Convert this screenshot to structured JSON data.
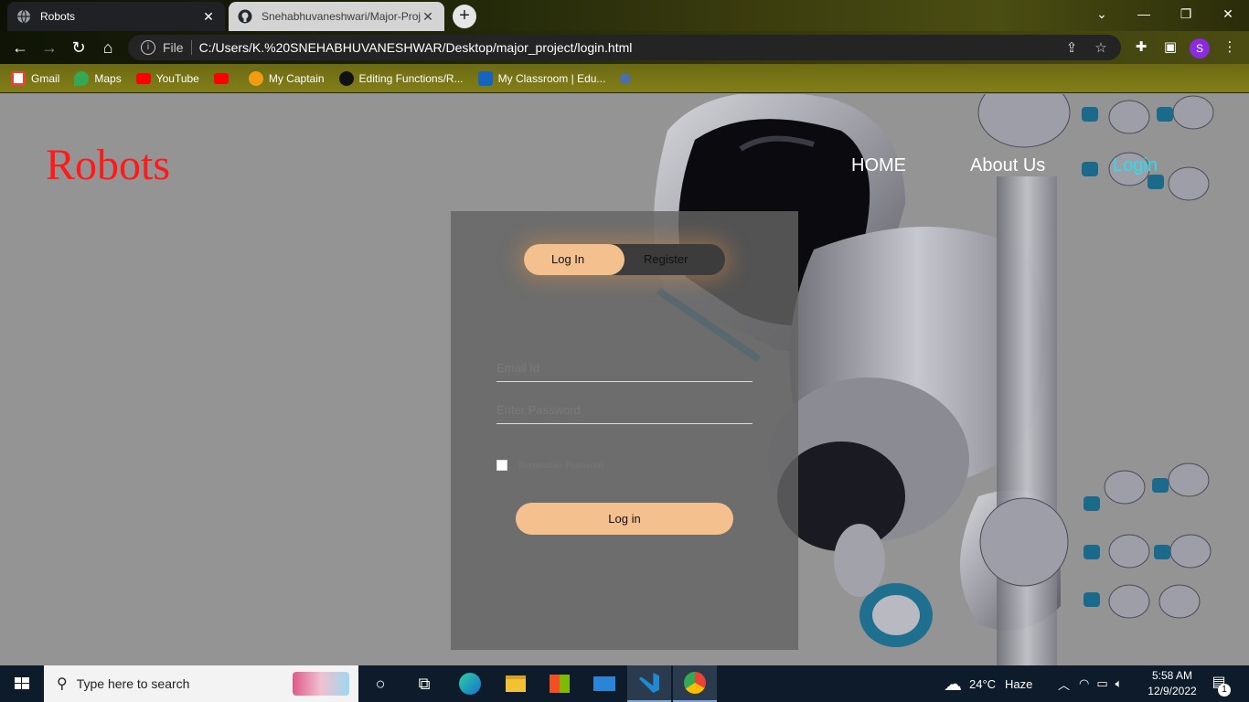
{
  "browser": {
    "tabs": [
      {
        "title": "Robots",
        "icon": "globe-icon",
        "active": true
      },
      {
        "title": "Snehabhuvaneshwari/Major-Proj",
        "icon": "github-icon",
        "active": false
      }
    ],
    "new_tab_label": "+",
    "address": {
      "scheme_label": "File",
      "url": "C:/Users/K.%20SNEHABHUVANESHWAR/Desktop/major_project/login.html"
    },
    "profile_initial": "S",
    "profile_color": "#8a2be2",
    "bookmarks": [
      {
        "label": "Gmail",
        "icon": "gmail-icon",
        "color": "#ea4335"
      },
      {
        "label": "Maps",
        "icon": "maps-icon",
        "color": "#34a853"
      },
      {
        "label": "YouTube",
        "icon": "youtube-icon",
        "color": "#ff0000"
      },
      {
        "label": "",
        "icon": "youtube-icon",
        "color": "#ff0000"
      },
      {
        "label": "My Captain",
        "icon": "mycaptain-icon",
        "color": "#f39c12"
      },
      {
        "label": "Editing Functions/R...",
        "icon": "github-icon",
        "color": "#111111"
      },
      {
        "label": "My Classroom | Edu...",
        "icon": "edureka-icon",
        "color": "#1565c0"
      }
    ]
  },
  "page": {
    "logo": "Robots",
    "logo_color": "#ff1a1a",
    "nav": [
      {
        "label": "HOME",
        "active": false
      },
      {
        "label": "About Us",
        "active": false
      },
      {
        "label": "Login",
        "active": true
      }
    ],
    "nav_active_color": "#22e0f0",
    "login_card": {
      "toggle": {
        "login_label": "Log In",
        "register_label": "Register"
      },
      "email_placeholder": "Email Id",
      "password_placeholder": "Enter Password",
      "remember_label": "Remember Password",
      "submit_label": "Log in"
    }
  },
  "taskbar": {
    "search_placeholder": "Type here to search",
    "weather": {
      "temp": "24°C",
      "condition": "Haze"
    },
    "clock": {
      "time": "5:58 AM",
      "date": "12/9/2022"
    },
    "notification_count": "1"
  }
}
